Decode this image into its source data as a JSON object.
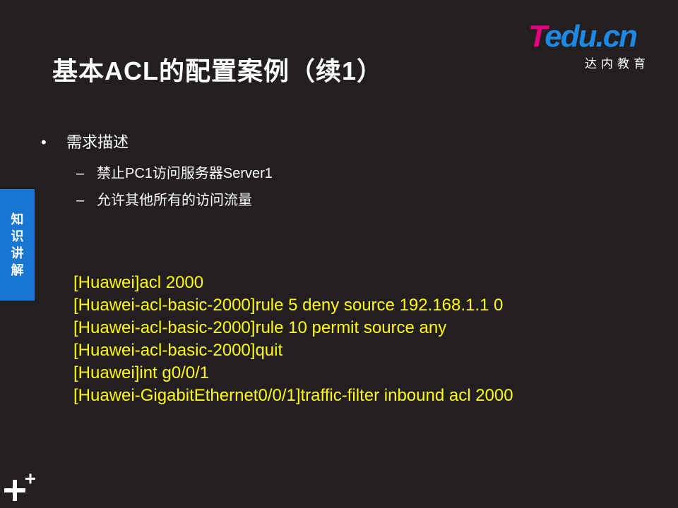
{
  "slide": {
    "title": "基本ACL的配置案例（续1）"
  },
  "logo": {
    "letter_t": "T",
    "letter_rest": "edu.cn",
    "subtitle": "达内教育",
    "colors": {
      "t": "#e5007f",
      "rest": "#1e88e5"
    }
  },
  "side_tab": {
    "chars": [
      "知",
      "识",
      "讲",
      "解"
    ],
    "color": "#1976d2"
  },
  "bullets": {
    "level1": {
      "marker": "•",
      "text": "需求描述"
    },
    "level2": [
      {
        "marker": "–",
        "text": "禁止PC1访问服务器Server1"
      },
      {
        "marker": "–",
        "text": "允许其他所有的访问流量"
      }
    ]
  },
  "code": {
    "color": "#ffff00",
    "lines": [
      "[Huawei]acl 2000",
      "[Huawei-acl-basic-2000]rule 5 deny source 192.168.1.1 0",
      "[Huawei-acl-basic-2000]rule 10 permit source any",
      "[Huawei-acl-basic-2000]quit",
      "[Huawei]int g0/0/1",
      "[Huawei-GigabitEthernet0/0/1]traffic-filter inbound acl 2000"
    ]
  },
  "footer": {
    "icon": "plus-icon"
  }
}
